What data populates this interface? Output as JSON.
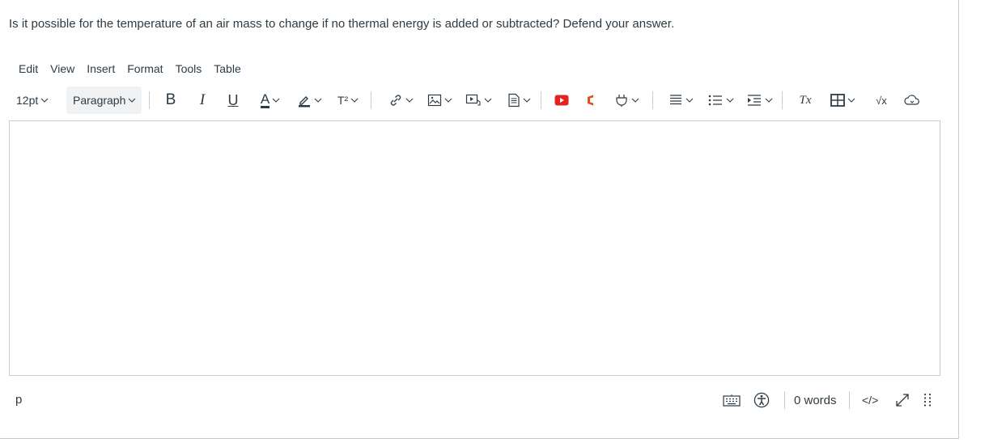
{
  "question": {
    "text": "Is it possible for the temperature of an air mass to change if no thermal energy is added or subtracted? Defend your answer."
  },
  "menubar": {
    "items": [
      "Edit",
      "View",
      "Insert",
      "Format",
      "Tools",
      "Table"
    ]
  },
  "toolbar": {
    "font_size": "12pt",
    "block_format": "Paragraph",
    "icons": [
      "bold-icon",
      "italic-icon",
      "underline-icon",
      "text-color-icon",
      "highlight-icon",
      "superscript-icon",
      "link-icon",
      "image-icon",
      "media-icon",
      "document-icon",
      "youtube-icon",
      "office-icon",
      "apps-icon",
      "align-icon",
      "list-icon",
      "indent-icon",
      "clear-formatting-icon",
      "table-icon",
      "math-icon",
      "cloud-icon"
    ],
    "bold_glyph": "B",
    "italic_glyph": "I",
    "underline_glyph": "U",
    "text_color_glyph": "A",
    "superscript_glyph": "T²",
    "math_glyph": "√x",
    "clear_format_glyph": "Tx"
  },
  "statusbar": {
    "path": "p",
    "word_count": "0 words",
    "html_toggle": "</>",
    "icons": [
      "keyboard-icon",
      "accessibility-icon",
      "expand-icon",
      "resize-handle-icon"
    ]
  },
  "colors": {
    "youtube": "#e4221f",
    "office": "#e74c1b",
    "text": "#2d3b45",
    "border": "#c7cdd1",
    "format_bg": "#f0f2f3"
  }
}
